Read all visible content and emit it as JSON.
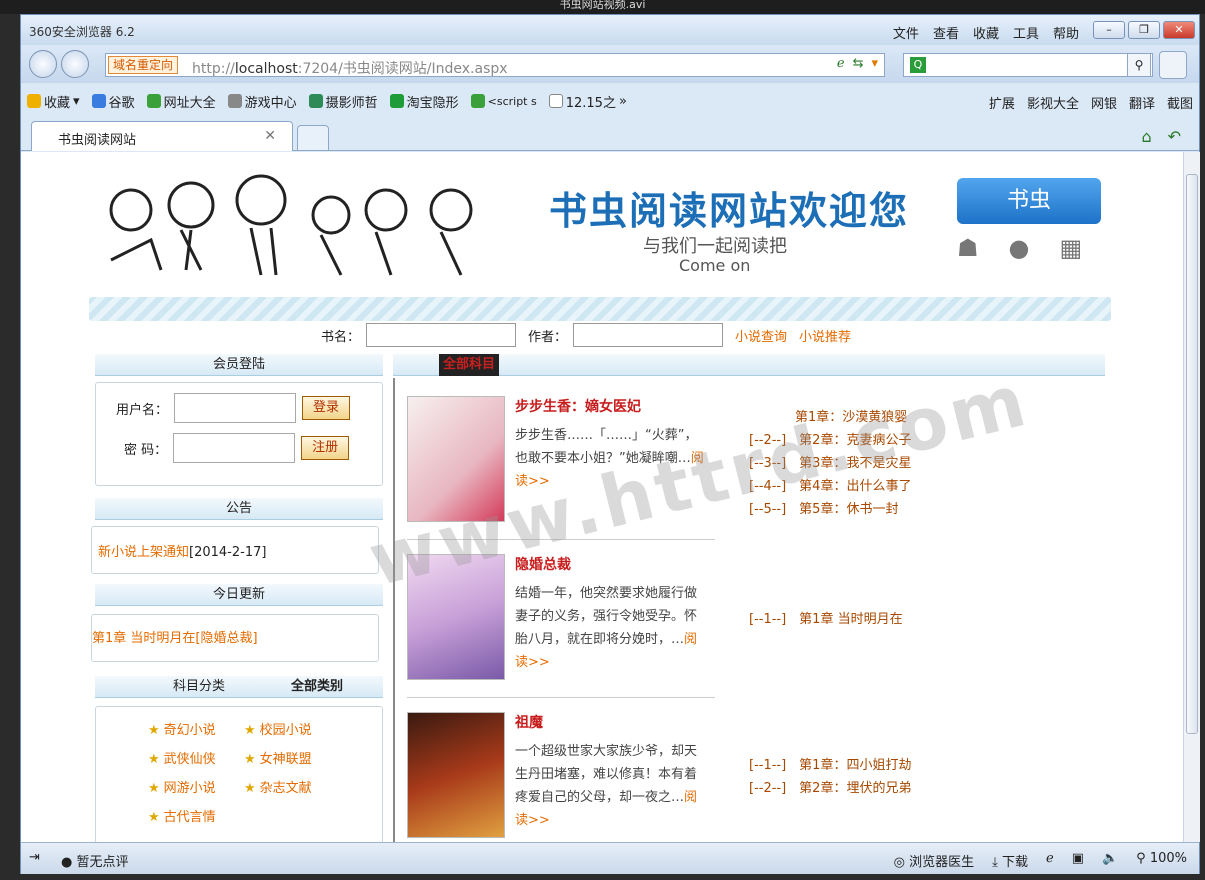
{
  "screen": {
    "video_title": "书虫网站视频.avi"
  },
  "browser": {
    "app_title": "360安全浏览器 6.2",
    "menus": [
      "文件",
      "查看",
      "收藏",
      "工具",
      "帮助"
    ],
    "address": {
      "redirect_label": "域名重定向",
      "url_prefix": "http://",
      "url_host": "localhost",
      "url_rest": ":7204/书虫阅读网站/Index.aspx"
    },
    "favorites": [
      "收藏",
      "谷歌",
      "网址大全",
      "游戏中心",
      "摄影师哲",
      "淘宝隐形",
      "<script s",
      "12.15之"
    ],
    "favorites_right": [
      "扩展",
      "影视大全",
      "网银",
      "翻译",
      "截图"
    ],
    "tab": {
      "title": "书虫阅读网站"
    },
    "status": {
      "left": "暂无点评",
      "doctor": "浏览器医生",
      "download": "下载",
      "zoom": "100%"
    }
  },
  "page": {
    "header": {
      "title": "书虫阅读网站欢迎您",
      "subtitle": "与我们一起阅读把",
      "subtitle2": "Come on",
      "badge": "书虫"
    },
    "search": {
      "bookname_label": "书名：",
      "author_label": "作者：",
      "query_link": "小说查询",
      "recommend_link": "小说推荐"
    },
    "login": {
      "head": "会员登陆",
      "user_label": "用户名：",
      "pass_label": "密 码：",
      "login_btn": "登录",
      "register_btn": "注册"
    },
    "notice": {
      "head": "公告",
      "item": "新小说上架通知",
      "date": "[2014-2-17]"
    },
    "today": {
      "head": "今日更新",
      "item": "第1章 当时明月在[隐婚总裁]"
    },
    "categories": {
      "head": "科目分类",
      "head_right": "全部类别",
      "items": [
        "奇幻小说",
        "校园小说",
        "武侠仙侠",
        "女神联盟",
        "网游小说",
        "杂志文献",
        "古代言情"
      ]
    },
    "books_head": "全部科目",
    "books": [
      {
        "title": "步步生香：嫡女医妃",
        "desc": "步步生香……「……」“火葬”，也敢不要本小姐？”她凝眸嘲…",
        "more": "阅读>>",
        "chapters": [
          "第1章：沙漠黄狼婴",
          "[--2--]　第2章：克妻病公子",
          "[--3--]　第3章：我不是灾星",
          "[--4--]　第4章：出什么事了",
          "[--5--]　第5章：休书一封"
        ]
      },
      {
        "title": "隐婚总裁",
        "desc": "结婚一年，他突然要求她履行做妻子的义务，强行令她受孕。怀胎八月，就在即将分娩时，…",
        "more": "阅读>>",
        "chapters": [
          "[--1--]　第1章 当时明月在"
        ]
      },
      {
        "title": "祖魔",
        "desc": "一个超级世家大家族少爷，却天生丹田堵塞，难以修真！本有着疼爱自己的父母，却一夜之…",
        "more": "阅读>>",
        "chapters": [
          "[--1--]　第1章：四小姐打劫",
          "[--2--]　第2章：埋伏的兄弟"
        ]
      }
    ],
    "watermark": "www.httrd.com"
  }
}
